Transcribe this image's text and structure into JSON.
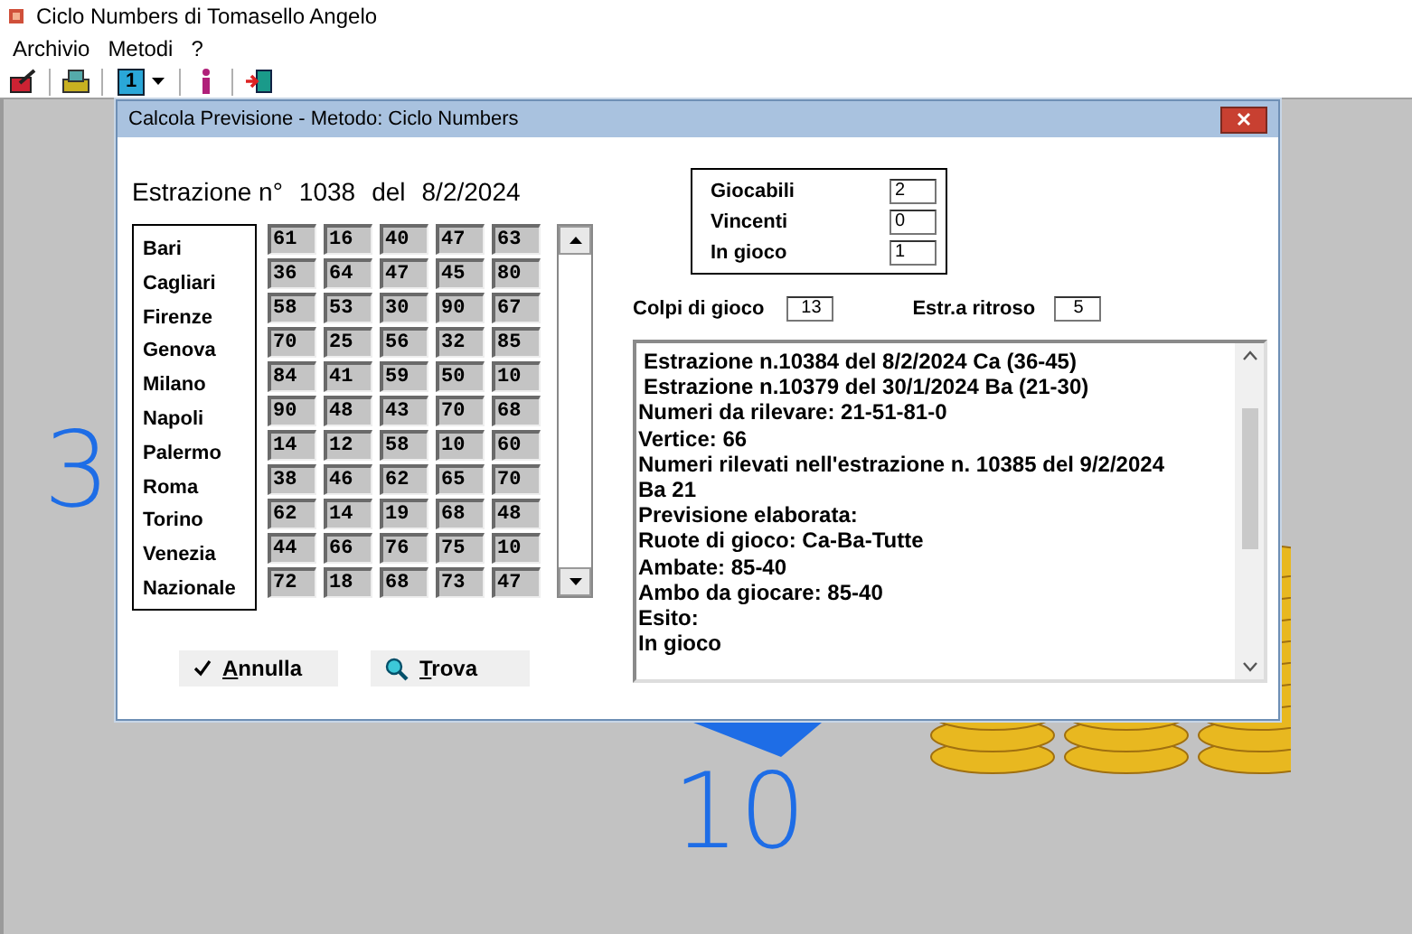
{
  "app_window": {
    "title": "Ciclo Numbers di Tomasello Angelo"
  },
  "menu": [
    "Archivio",
    "Metodi",
    "?"
  ],
  "toolbar": {
    "number_button": "1"
  },
  "desktop": {
    "left_number": "3",
    "bottom_number": "10"
  },
  "dialog": {
    "title": "Calcola Previsione - Metodo: Ciclo Numbers",
    "draw_label": "Estrazione n°",
    "draw_number": "1038",
    "date_label": "del",
    "date": "8/2/2024",
    "wheels": [
      "Bari",
      "Cagliari",
      "Firenze",
      "Genova",
      "Milano",
      "Napoli",
      "Palermo",
      "Roma",
      "Torino",
      "Venezia",
      "Nazionale"
    ],
    "numbers": [
      [
        "61",
        "16",
        "40",
        "47",
        "63"
      ],
      [
        "36",
        "64",
        "47",
        "45",
        "80"
      ],
      [
        "58",
        "53",
        "30",
        "90",
        "67"
      ],
      [
        "70",
        "25",
        "56",
        "32",
        "85"
      ],
      [
        "84",
        "41",
        "59",
        "50",
        "10"
      ],
      [
        "90",
        "48",
        "43",
        "70",
        "68"
      ],
      [
        "14",
        "12",
        "58",
        "10",
        "60"
      ],
      [
        "38",
        "46",
        "62",
        "65",
        "70"
      ],
      [
        "62",
        "14",
        "19",
        "68",
        "48"
      ],
      [
        "44",
        "66",
        "76",
        "75",
        "10"
      ],
      [
        "72",
        "18",
        "68",
        "73",
        "47"
      ]
    ],
    "stats": [
      {
        "label": "Giocabili",
        "value": "2"
      },
      {
        "label": "Vincenti",
        "value": "0"
      },
      {
        "label": "In gioco",
        "value": "1"
      }
    ],
    "colpi": {
      "label": "Colpi di gioco",
      "value": "13"
    },
    "ritroso": {
      "label": "Estr.a ritroso",
      "value": "5"
    },
    "report_lines": [
      {
        "text": "Estrazione n.10384 del 8/2/2024 Ca (36-45)",
        "indented": true
      },
      {
        "text": "Estrazione n.10379 del 30/1/2024 Ba (21-30)",
        "indented": true
      },
      {
        "text": "Numeri da rilevare: 21-51-81-0",
        "indented": false
      },
      {
        "text": "Vertice: 66",
        "indented": false
      },
      {
        "text": "Numeri rilevati nell'estrazione n. 10385 del 9/2/2024",
        "indented": false
      },
      {
        "text": "Ba 21",
        "indented": false
      },
      {
        "text": "Previsione elaborata:",
        "indented": false
      },
      {
        "text": "Ruote di gioco: Ca-Ba-Tutte",
        "indented": false
      },
      {
        "text": "Ambate: 85-40",
        "indented": false
      },
      {
        "text": "Ambo da giocare: 85-40",
        "indented": false
      },
      {
        "text": "Esito:",
        "indented": false
      },
      {
        "text": "In gioco",
        "indented": false
      }
    ],
    "buttons": [
      {
        "label": "Annulla",
        "kind": "cancel"
      },
      {
        "label": "Trova",
        "kind": "find"
      }
    ]
  }
}
